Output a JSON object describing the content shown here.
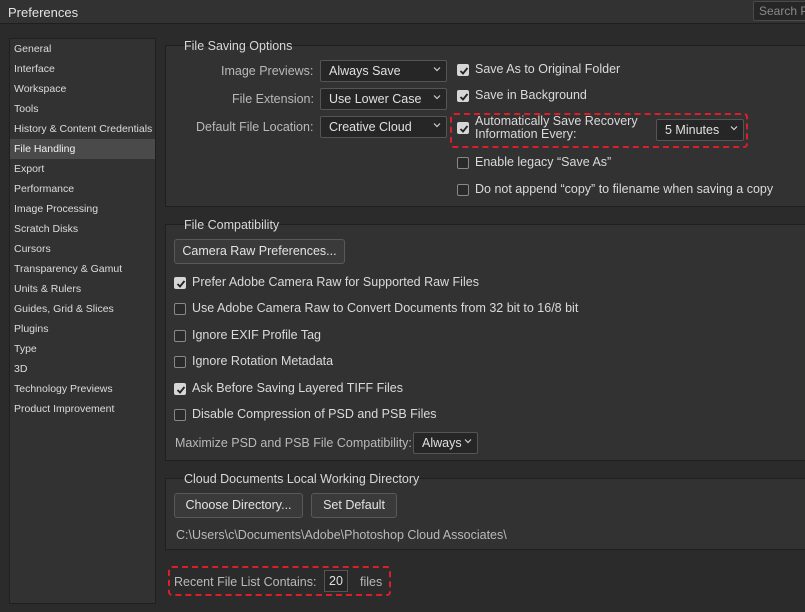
{
  "window": {
    "title": "Preferences",
    "search_placeholder": "Search Pr"
  },
  "sidebar": {
    "items": [
      {
        "label": "General"
      },
      {
        "label": "Interface"
      },
      {
        "label": "Workspace"
      },
      {
        "label": "Tools"
      },
      {
        "label": "History & Content Credentials"
      },
      {
        "label": "File Handling",
        "active": true
      },
      {
        "label": "Export"
      },
      {
        "label": "Performance"
      },
      {
        "label": "Image Processing"
      },
      {
        "label": "Scratch Disks"
      },
      {
        "label": "Cursors"
      },
      {
        "label": "Transparency & Gamut"
      },
      {
        "label": "Units & Rulers"
      },
      {
        "label": "Guides, Grid & Slices"
      },
      {
        "label": "Plugins"
      },
      {
        "label": "Type"
      },
      {
        "label": "3D"
      },
      {
        "label": "Technology Previews"
      },
      {
        "label": "Product Improvement"
      }
    ]
  },
  "file_saving": {
    "title": "File Saving Options",
    "image_previews_label": "Image Previews:",
    "image_previews_value": "Always Save",
    "file_extension_label": "File Extension:",
    "file_extension_value": "Use Lower Case",
    "default_location_label": "Default File Location:",
    "default_location_value": "Creative Cloud",
    "save_as_original": {
      "label": "Save As to Original Folder",
      "checked": true
    },
    "save_in_background": {
      "label": "Save in Background",
      "checked": true
    },
    "auto_save": {
      "label_line1": "Automatically Save Recovery",
      "label_line2": "Information Every:",
      "checked": true
    },
    "auto_save_interval": "5 Minutes",
    "legacy_save_as": {
      "label": "Enable legacy “Save As”",
      "checked": false
    },
    "no_copy": {
      "label": "Do not append “copy” to filename when saving a copy",
      "checked": false
    }
  },
  "file_compat": {
    "title": "File Compatibility",
    "camera_raw_button": "Camera Raw Preferences...",
    "options": [
      {
        "label": "Prefer Adobe Camera Raw for Supported Raw Files",
        "checked": true
      },
      {
        "label": "Use Adobe Camera Raw to Convert Documents from 32 bit to 16/8 bit",
        "checked": false
      },
      {
        "label": "Ignore EXIF Profile Tag",
        "checked": false
      },
      {
        "label": "Ignore Rotation Metadata",
        "checked": false
      },
      {
        "label": "Ask Before Saving Layered TIFF Files",
        "checked": true
      },
      {
        "label": "Disable Compression of PSD and PSB Files",
        "checked": false
      }
    ],
    "maximize_label": "Maximize PSD and PSB File Compatibility:",
    "maximize_value": "Always"
  },
  "cloud_docs": {
    "title": "Cloud Documents Local Working Directory",
    "choose_button": "Choose Directory...",
    "default_button": "Set Default",
    "path": "C:\\Users\\c\\Documents\\Adobe\\Photoshop Cloud Associates\\"
  },
  "recent_files": {
    "label": "Recent File List Contains:",
    "value": "20",
    "suffix": "files"
  },
  "colors": {
    "highlight": "#d9202a",
    "panel": "#323232",
    "background": "#2b2b2b"
  }
}
